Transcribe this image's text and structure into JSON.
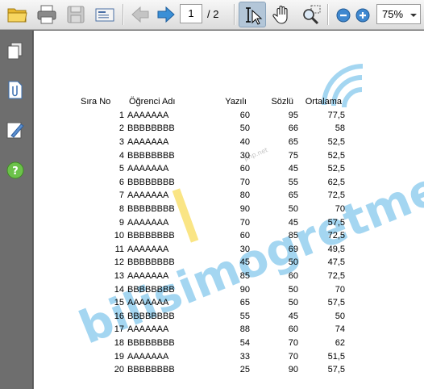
{
  "toolbar": {
    "icons": [
      "open-folder-icon",
      "print-icon",
      "save-icon",
      "email-icon",
      "previous-page-icon",
      "next-page-icon",
      "select-cursor-icon",
      "hand-tool-icon",
      "marquee-zoom-icon",
      "zoom-out-icon",
      "zoom-in-icon"
    ],
    "current_page": "1",
    "total_pages": "/ 2",
    "zoom": "75%"
  },
  "sidebar": {
    "icons": [
      "pages-icon",
      "attachments-icon",
      "signatures-icon",
      "help-icon"
    ]
  },
  "table": {
    "headers": [
      "Sıra No",
      "Öğrenci Adı",
      "Yazılı",
      "Sözlü",
      "Ortalama"
    ],
    "rows": [
      [
        "1",
        "AAAAAAA",
        "60",
        "95",
        "77,5"
      ],
      [
        "2",
        "BBBBBBBB",
        "50",
        "66",
        "58"
      ],
      [
        "3",
        "AAAAAAA",
        "40",
        "65",
        "52,5"
      ],
      [
        "4",
        "BBBBBBBB",
        "30",
        "75",
        "52,5"
      ],
      [
        "5",
        "AAAAAAA",
        "60",
        "45",
        "52,5"
      ],
      [
        "6",
        "BBBBBBBB",
        "70",
        "55",
        "62,5"
      ],
      [
        "7",
        "AAAAAAA",
        "80",
        "65",
        "72,5"
      ],
      [
        "8",
        "BBBBBBBB",
        "90",
        "50",
        "70"
      ],
      [
        "9",
        "AAAAAAA",
        "70",
        "45",
        "57,5"
      ],
      [
        "10",
        "BBBBBBBB",
        "60",
        "85",
        "72,5"
      ],
      [
        "11",
        "AAAAAAA",
        "30",
        "69",
        "49,5"
      ],
      [
        "12",
        "BBBBBBBB",
        "45",
        "50",
        "47,5"
      ],
      [
        "13",
        "AAAAAAA",
        "85",
        "60",
        "72,5"
      ],
      [
        "14",
        "BBBBBBBB",
        "90",
        "50",
        "70"
      ],
      [
        "15",
        "AAAAAAA",
        "65",
        "50",
        "57,5"
      ],
      [
        "16",
        "BBBBBBBB",
        "55",
        "45",
        "50"
      ],
      [
        "17",
        "AAAAAAA",
        "88",
        "60",
        "74"
      ],
      [
        "18",
        "BBBBBBBB",
        "54",
        "70",
        "62"
      ],
      [
        "19",
        "AAAAAAA",
        "33",
        "70",
        "51,5"
      ],
      [
        "20",
        "BBBBBBBB",
        "25",
        "90",
        "57,5"
      ]
    ]
  },
  "watermark": {
    "text": "bilisimogretmeni.com",
    "subtext": "php.net"
  },
  "colors": {
    "watermark": "#5bb5e6",
    "accent_yellow": "#f5d020",
    "selected_tool": "#b3c6d8"
  }
}
